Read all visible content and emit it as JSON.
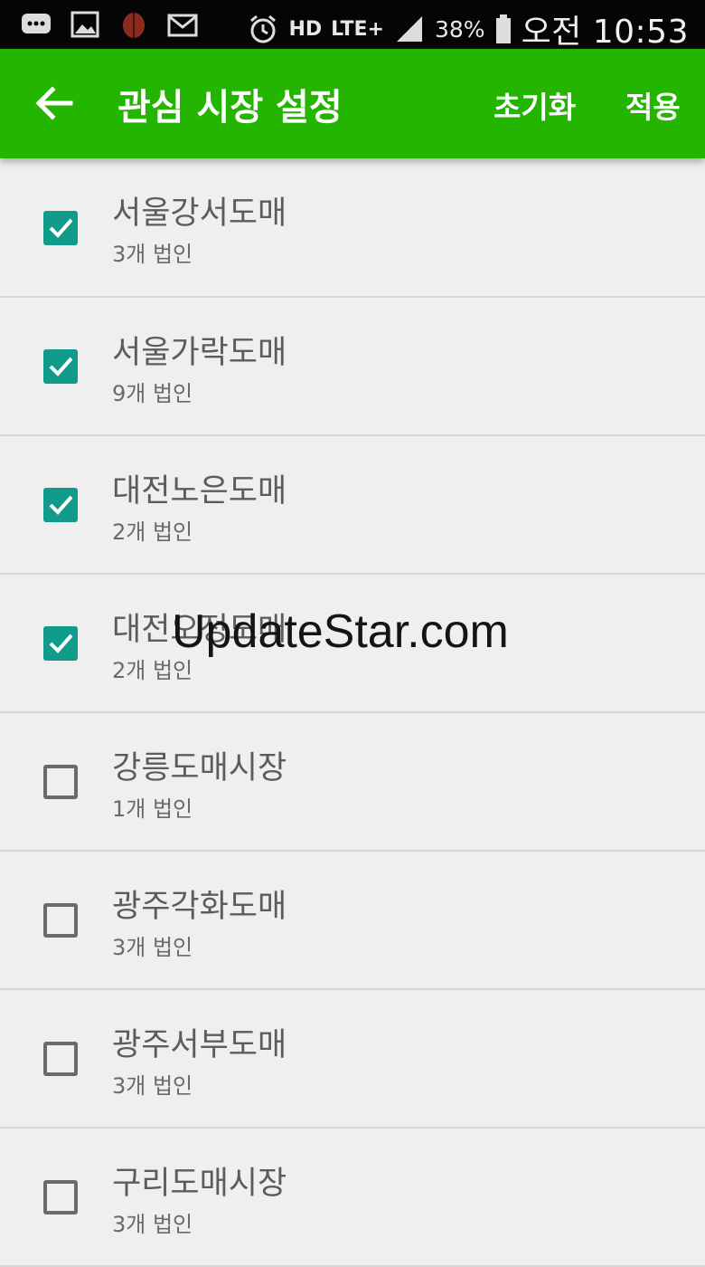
{
  "status_bar": {
    "battery": "38%",
    "time": "오전 10:53",
    "hd": "HD",
    "network": "LTE+"
  },
  "appbar": {
    "title": "관심 시장 설정",
    "reset_label": "초기화",
    "apply_label": "적용"
  },
  "markets": [
    {
      "name": "서울강서도매",
      "count": "3개 법인",
      "checked": true
    },
    {
      "name": "서울가락도매",
      "count": "9개 법인",
      "checked": true
    },
    {
      "name": "대전노은도매",
      "count": "2개 법인",
      "checked": true
    },
    {
      "name": "대전오정도매",
      "count": "2개 법인",
      "checked": true
    },
    {
      "name": "강릉도매시장",
      "count": "1개 법인",
      "checked": false
    },
    {
      "name": "광주각화도매",
      "count": "3개 법인",
      "checked": false
    },
    {
      "name": "광주서부도매",
      "count": "3개 법인",
      "checked": false
    },
    {
      "name": "구리도매시장",
      "count": "3개 법인",
      "checked": false
    }
  ],
  "watermark": "UpdateStar.com",
  "colors": {
    "appbar": "#24b500",
    "checkbox_checked": "#119b8a",
    "background": "#efefef"
  }
}
